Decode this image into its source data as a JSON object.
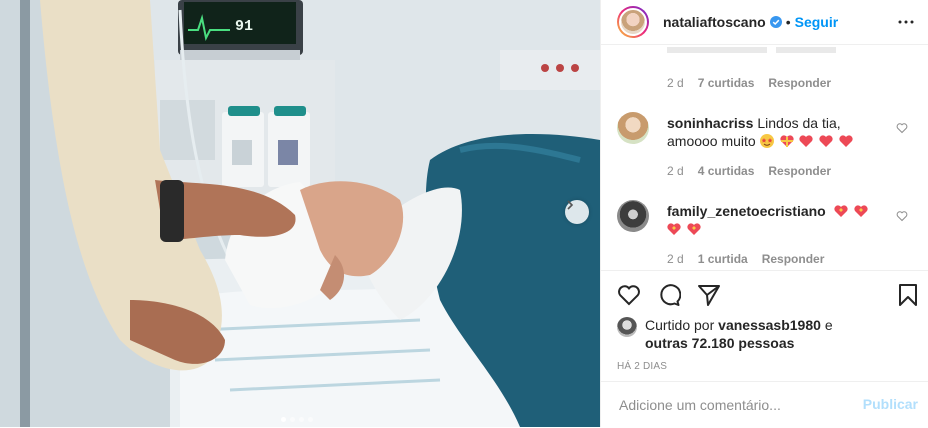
{
  "post": {
    "username": "nataliaftoscano",
    "follow_label": "Seguir",
    "separator": "•",
    "verified": true,
    "monitor_value": "91",
    "carousel": {
      "count": 4,
      "active_index": 0
    }
  },
  "comments": {
    "partial_meta": {
      "time": "2 d",
      "likes": "7 curtidas",
      "reply": "Responder"
    },
    "items": [
      {
        "user": "soninhacriss",
        "text": "Lindos da tia, amoooo muito",
        "emojis": [
          "star-struck-emoji",
          "gift-heart-emoji",
          "red-heart-emoji",
          "red-heart-emoji",
          "red-heart-emoji"
        ],
        "time": "2 d",
        "likes": "4 curtidas",
        "reply": "Responder"
      },
      {
        "user": "family_zenetoecristiano",
        "text": "",
        "emojis": [
          "sparkling-heart-emoji",
          "sparkling-heart-emoji",
          "sparkling-heart-emoji",
          "sparkling-heart-emoji"
        ],
        "time": "2 d",
        "likes": "1 curtida",
        "reply": "Responder"
      }
    ]
  },
  "likes": {
    "prefix": "Curtido por",
    "user": "vanessasb1980",
    "connector": "e",
    "others": "outras 72.180 pessoas"
  },
  "timestamp": "HÁ 2 DIAS",
  "compose": {
    "placeholder": "Adicione um comentário...",
    "publish_label": "Publicar"
  },
  "colors": {
    "link": "#0095f6",
    "publish_disabled": "#b2dffc",
    "meta": "#8e8e8e",
    "heart_red": "#ed4956"
  }
}
